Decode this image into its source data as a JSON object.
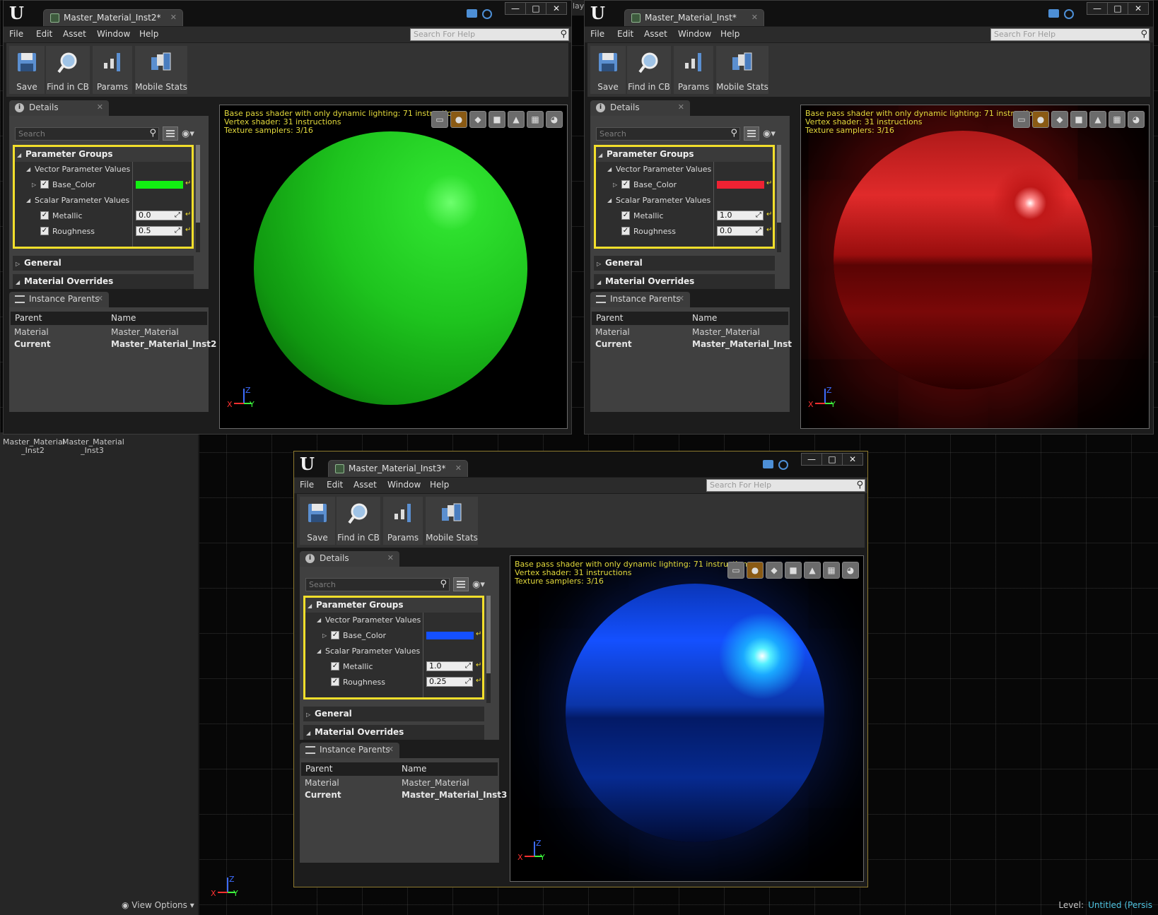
{
  "behind": {
    "tab_fragment": "lay"
  },
  "content_browser": {
    "items": [
      "Master_Material\n_Inst2",
      "Master_Material\n_Inst3"
    ],
    "view_options": "View Options"
  },
  "level": {
    "label": "Level:",
    "value": "Untitled (Persis"
  },
  "menus": [
    "File",
    "Edit",
    "Asset",
    "Window",
    "Help"
  ],
  "help_search_placeholder": "Search For Help",
  "toolbar": {
    "save": "Save",
    "find": "Find in CB",
    "params": "Params",
    "mobile": "Mobile Stats"
  },
  "details": {
    "tab": "Details",
    "search_placeholder": "Search",
    "param_groups": "Parameter Groups",
    "vector_values": "Vector Parameter Values",
    "base_color": "Base_Color",
    "scalar_values": "Scalar Parameter Values",
    "metallic": "Metallic",
    "roughness": "Roughness",
    "general": "General",
    "overrides": "Material Overrides"
  },
  "instance_parents": {
    "tab": "Instance Parents",
    "col_parent": "Parent",
    "col_name": "Name",
    "row1_parent": "Material",
    "row1_name": "Master_Material",
    "row2_parent": "Current"
  },
  "preview_stats": {
    "line1": "Base pass shader with only dynamic lighting: 71 instructions",
    "line2": "Vertex shader: 31 instructions",
    "line3": "Texture samplers: 3/16"
  },
  "axes": {
    "z": "Z",
    "y": "Y",
    "x": "X"
  },
  "windows": [
    {
      "tab_title": "Master_Material_Inst2*",
      "base_color_hex": "#12f012",
      "metallic": "0.0",
      "roughness": "0.5",
      "current_name": "Master_Material_Inst2"
    },
    {
      "tab_title": "Master_Material_Inst*",
      "base_color_hex": "#ee2233",
      "metallic": "1.0",
      "roughness": "0.0",
      "current_name": "Master_Material_Inst"
    },
    {
      "tab_title": "Master_Material_Inst3*",
      "base_color_hex": "#1450ff",
      "metallic": "1.0",
      "roughness": "0.25",
      "current_name": "Master_Material_Inst3"
    }
  ]
}
